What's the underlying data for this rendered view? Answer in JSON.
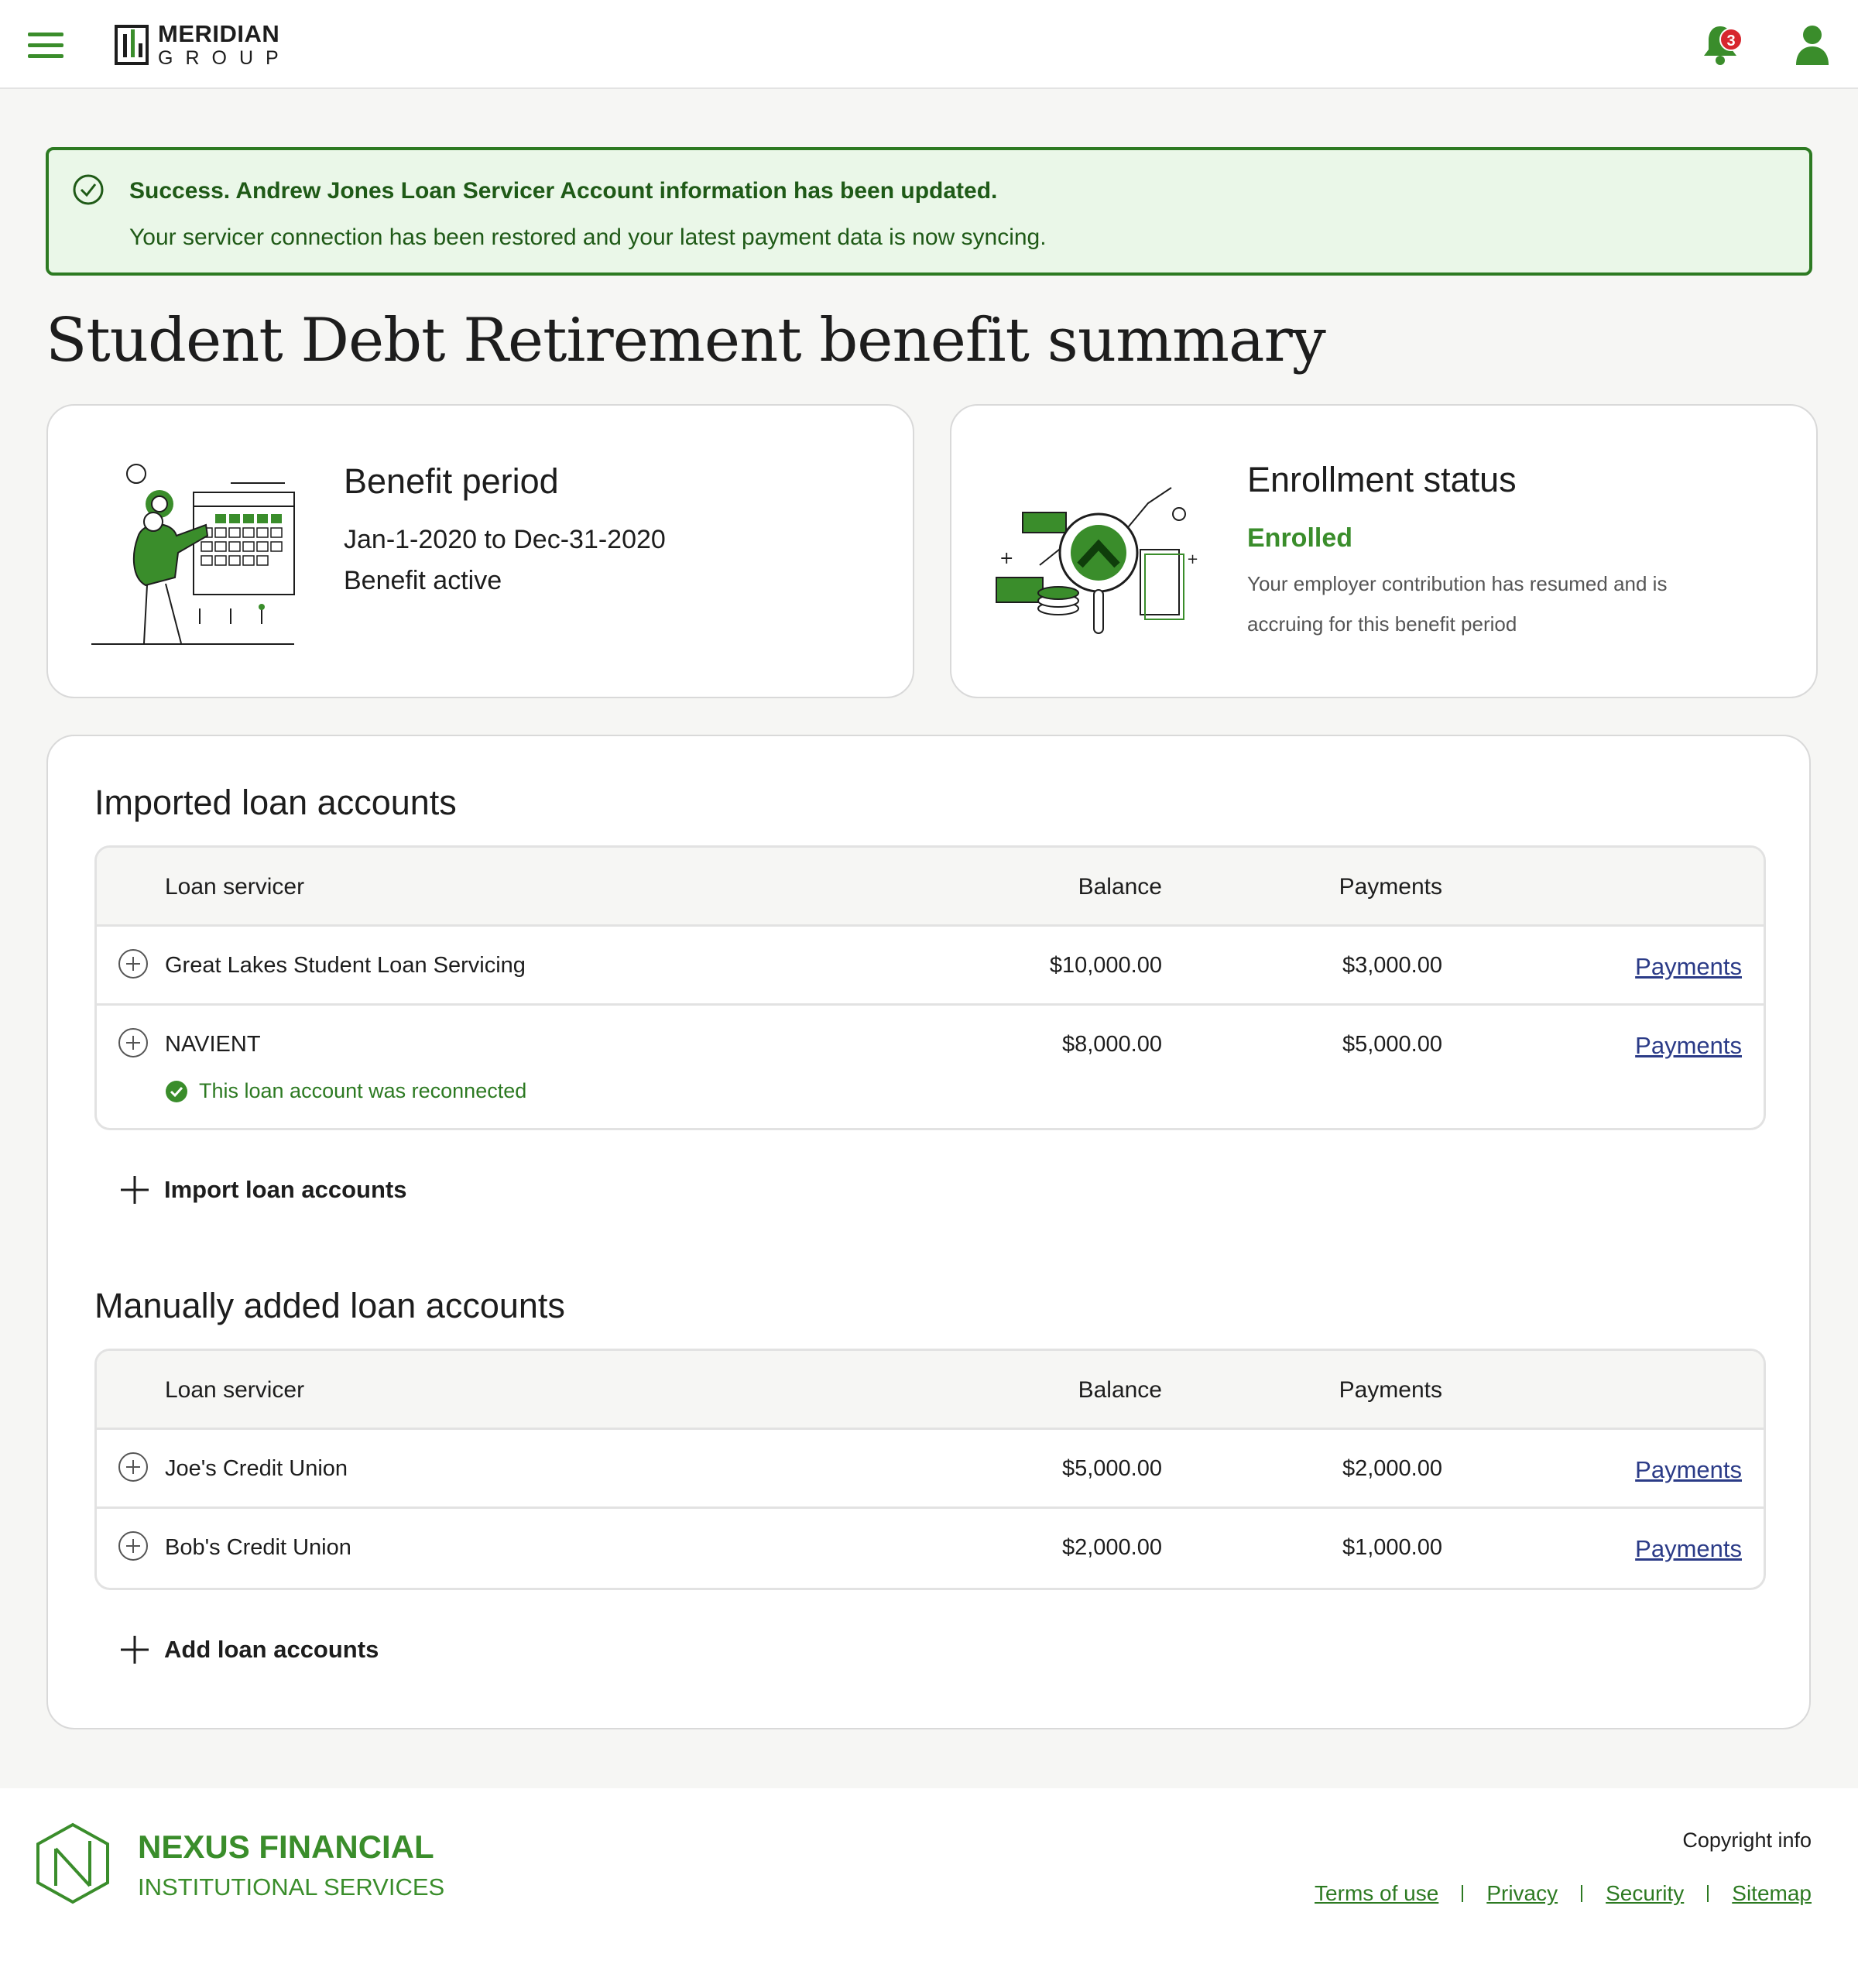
{
  "header": {
    "logo_line1": "MERIDIAN",
    "logo_line2": "GROUP",
    "notification_count": "3",
    "icons": [
      "hamburger-menu-icon",
      "bell-icon",
      "user-icon"
    ]
  },
  "alert": {
    "title": "Success. Andrew Jones Loan Servicer Account information has been updated.",
    "body": "Your servicer connection has been restored and your latest payment data is now syncing."
  },
  "page_title": "Student Debt Retirement benefit summary",
  "benefit_card": {
    "title": "Benefit period",
    "dates": "Jan-1-2020 to Dec-31-2020",
    "status": "Benefit active"
  },
  "enrollment_card": {
    "title": "Enrollment status",
    "status": "Enrolled",
    "description": "Your employer contribution has resumed and is accruing for this benefit period"
  },
  "imported": {
    "title": "Imported loan accounts",
    "headers": {
      "servicer": "Loan servicer",
      "balance": "Balance",
      "payments": "Payments"
    },
    "rows": [
      {
        "name": "Great Lakes Student Loan Servicing",
        "balance": "$10,000.00",
        "payments": "$3,000.00",
        "link": "Payments"
      },
      {
        "name": "NAVIENT",
        "balance": "$8,000.00",
        "payments": "$5,000.00",
        "link": "Payments",
        "note": "This loan account was reconnected"
      }
    ],
    "action": "Import loan accounts"
  },
  "manual": {
    "title": "Manually added loan accounts",
    "headers": {
      "servicer": "Loan servicer",
      "balance": "Balance",
      "payments": "Payments"
    },
    "rows": [
      {
        "name": "Joe's Credit Union",
        "balance": "$5,000.00",
        "payments": "$2,000.00",
        "link": "Payments"
      },
      {
        "name": "Bob's Credit Union",
        "balance": "$2,000.00",
        "payments": "$1,000.00",
        "link": "Payments"
      }
    ],
    "action": "Add loan accounts"
  },
  "footer": {
    "brand_line1": "NEXUS FINANCIAL",
    "brand_line2": "INSTITUTIONAL SERVICES",
    "copyright": "Copyright info",
    "links": [
      "Terms of use",
      "Privacy",
      "Security",
      "Sitemap"
    ]
  },
  "colors": {
    "brand_green": "#3a8d2b",
    "alert_border": "#2d7a22",
    "alert_bg": "#eaf7e8",
    "link_blue": "#2b3b87",
    "badge_red": "#d7262e"
  }
}
